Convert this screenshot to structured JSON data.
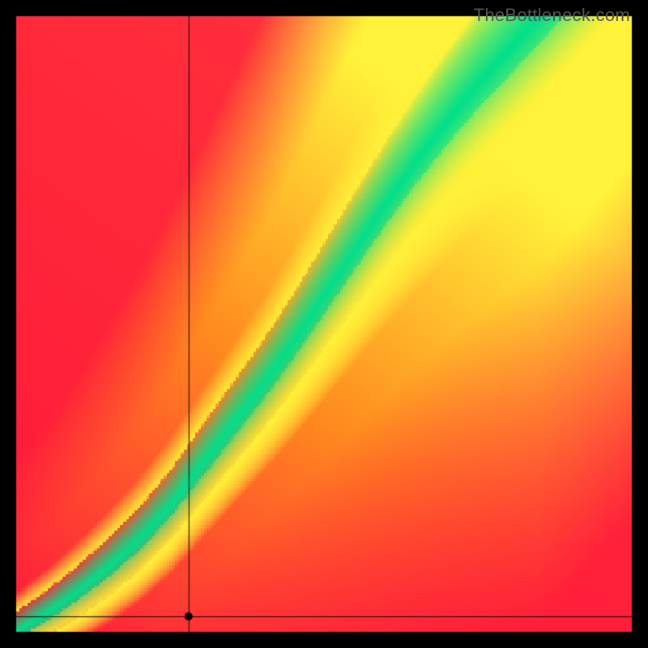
{
  "watermark": "TheBottleneck.com",
  "chart_data": {
    "type": "heatmap",
    "title": "",
    "xlabel": "",
    "ylabel": "",
    "xlim": [
      0,
      1
    ],
    "ylim": [
      0,
      1
    ],
    "grid": false,
    "legend": false,
    "outer_border_px": 20,
    "inner_size_px": 760,
    "crosshair": {
      "x": 0.28,
      "y": 0.025
    },
    "optimal_curve_xy": [
      [
        0.0,
        0.0
      ],
      [
        0.05,
        0.03
      ],
      [
        0.1,
        0.065
      ],
      [
        0.15,
        0.105
      ],
      [
        0.2,
        0.15
      ],
      [
        0.25,
        0.205
      ],
      [
        0.3,
        0.27
      ],
      [
        0.35,
        0.335
      ],
      [
        0.4,
        0.4
      ],
      [
        0.45,
        0.47
      ],
      [
        0.5,
        0.545
      ],
      [
        0.55,
        0.62
      ],
      [
        0.6,
        0.695
      ],
      [
        0.65,
        0.765
      ],
      [
        0.7,
        0.83
      ],
      [
        0.75,
        0.89
      ],
      [
        0.8,
        0.945
      ],
      [
        0.845,
        0.995
      ]
    ],
    "secondary_band_offset": 0.085,
    "band_half_width_start": 0.016,
    "band_half_width_end": 0.065,
    "colors": {
      "green": "#00e08c",
      "yellow": "#fff23a",
      "orange": "#ff8a1f",
      "red": "#ff1a3c"
    },
    "annotations": []
  }
}
